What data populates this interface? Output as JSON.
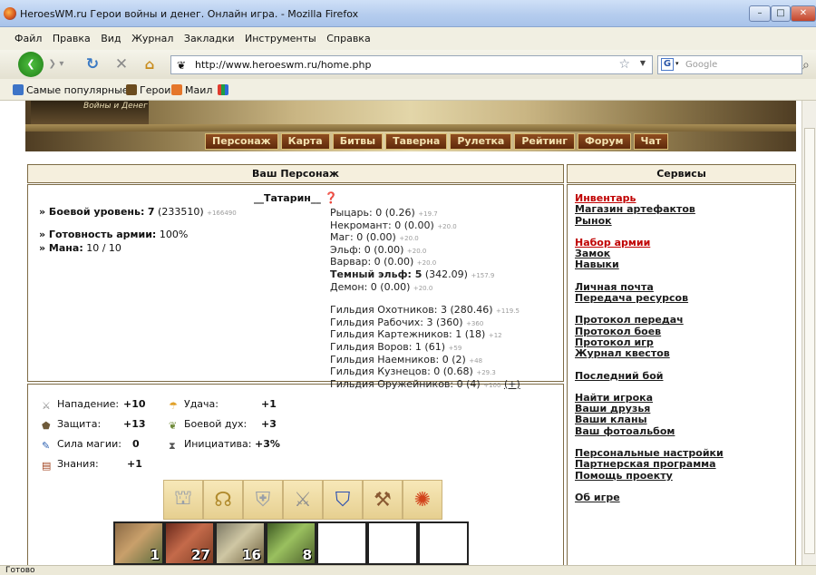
{
  "window": {
    "title": "HeroesWM.ru Герои войны и денег. Онлайн игра. - Mozilla Firefox",
    "controls": [
      "–",
      "□",
      "✕"
    ]
  },
  "menubar": [
    "Файл",
    "Правка",
    "Вид",
    "Журнал",
    "Закладки",
    "Инструменты",
    "Справка"
  ],
  "nav": {
    "url": "http://www.heroeswm.ru/home.php",
    "search_placeholder": "Google",
    "search_engine": "G"
  },
  "bookmarks": [
    "Самые популярные",
    "Герои",
    "Маил"
  ],
  "banner": {
    "logo_text": "Войны и Денег",
    "menu": [
      "Персонаж",
      "Карта",
      "Битвы",
      "Таверна",
      "Рулетка",
      "Рейтинг",
      "Форум",
      "Чат"
    ]
  },
  "character_panel": {
    "title": "Ваш Персонаж",
    "nickname": "__Татарин__",
    "level_label": "» Боевой уровень:",
    "level_value": "7",
    "level_exp": "(233510)",
    "level_next": "+166490",
    "readiness_label": "» Готовность армии:",
    "readiness_value": "100%",
    "mana_label": "» Мана:",
    "mana_value": "10 / 10",
    "factions": [
      {
        "text": "Рыцарь: 0 (0.26)",
        "small": "+19.7",
        "bold": false
      },
      {
        "text": "Некромант: 0 (0.00)",
        "small": "+20.0",
        "bold": false
      },
      {
        "text": "Маг: 0 (0.00)",
        "small": "+20.0",
        "bold": false
      },
      {
        "text": "Эльф: 0 (0.00)",
        "small": "+20.0",
        "bold": false
      },
      {
        "text": "Варвар: 0 (0.00)",
        "small": "+20.0",
        "bold": false
      },
      {
        "text": "Темный эльф: 5",
        "after": " (342.09)",
        "small": "+157.9",
        "bold": true
      },
      {
        "text": "Демон: 0 (0.00)",
        "small": "+20.0",
        "bold": false
      }
    ],
    "guilds": [
      {
        "text": "Гильдия Охотников: 3 (280.46)",
        "small": "+119.5"
      },
      {
        "text": "Гильдия Рабочих: 3 (360)",
        "small": "+360"
      },
      {
        "text": "Гильдия Картежников: 1 (18)",
        "small": "+12"
      },
      {
        "text": "Гильдия Воров: 1 (61)",
        "small": "+59"
      },
      {
        "text": "Гильдия Наемников: 0 (2)",
        "small": "+48"
      },
      {
        "text": "Гильдия Кузнецов: 0 (0.68)",
        "small": "+29.3"
      },
      {
        "text": "Гильдия Оружейников: 0 (4)",
        "small": "+100",
        "extra": "(+)"
      }
    ]
  },
  "attributes": [
    {
      "label": "Нападение:",
      "value": "+10"
    },
    {
      "label": "Защита:",
      "value": "+13"
    },
    {
      "label": "Сила магии:",
      "value": "0"
    },
    {
      "label": "Знания:",
      "value": "+1"
    },
    {
      "label": "Удача:",
      "value": "+1"
    },
    {
      "label": "Боевой дух:",
      "value": "+3"
    },
    {
      "label": "Инициатива:",
      "value": "+3%"
    }
  ],
  "equipment": [
    "hood-icon",
    "amulet-icon",
    "armor-icon",
    "sword-icon",
    "shield-icon",
    "boots-icon",
    "ring-icon"
  ],
  "army": [
    {
      "count": "1"
    },
    {
      "count": "27"
    },
    {
      "count": "16"
    },
    {
      "count": "8"
    },
    {
      "count": ""
    },
    {
      "count": ""
    },
    {
      "count": ""
    }
  ],
  "services": {
    "title": "Сервисы",
    "groups": [
      [
        {
          "label": "Инвентарь",
          "red": true
        },
        {
          "label": "Магазин артефактов"
        },
        {
          "label": "Рынок"
        }
      ],
      [
        {
          "label": "Набор армии",
          "red": true
        },
        {
          "label": "Замок"
        },
        {
          "label": "Навыки"
        }
      ],
      [
        {
          "label": "Личная почта"
        },
        {
          "label": "Передача ресурсов"
        }
      ],
      [
        {
          "label": "Протокол передач"
        },
        {
          "label": "Протокол боев"
        },
        {
          "label": "Протокол игр"
        },
        {
          "label": "Журнал квестов"
        }
      ],
      [
        {
          "label": "Последний бой"
        }
      ],
      [
        {
          "label": "Найти игрока"
        },
        {
          "label": "Ваши друзья"
        },
        {
          "label": "Ваши кланы"
        },
        {
          "label": "Ваш фотоальбом"
        }
      ],
      [
        {
          "label": "Персональные настройки"
        },
        {
          "label": "Партнерская программа"
        },
        {
          "label": "Помощь проекту"
        }
      ],
      [
        {
          "label": "Об игре"
        }
      ]
    ]
  },
  "status": "Готово"
}
